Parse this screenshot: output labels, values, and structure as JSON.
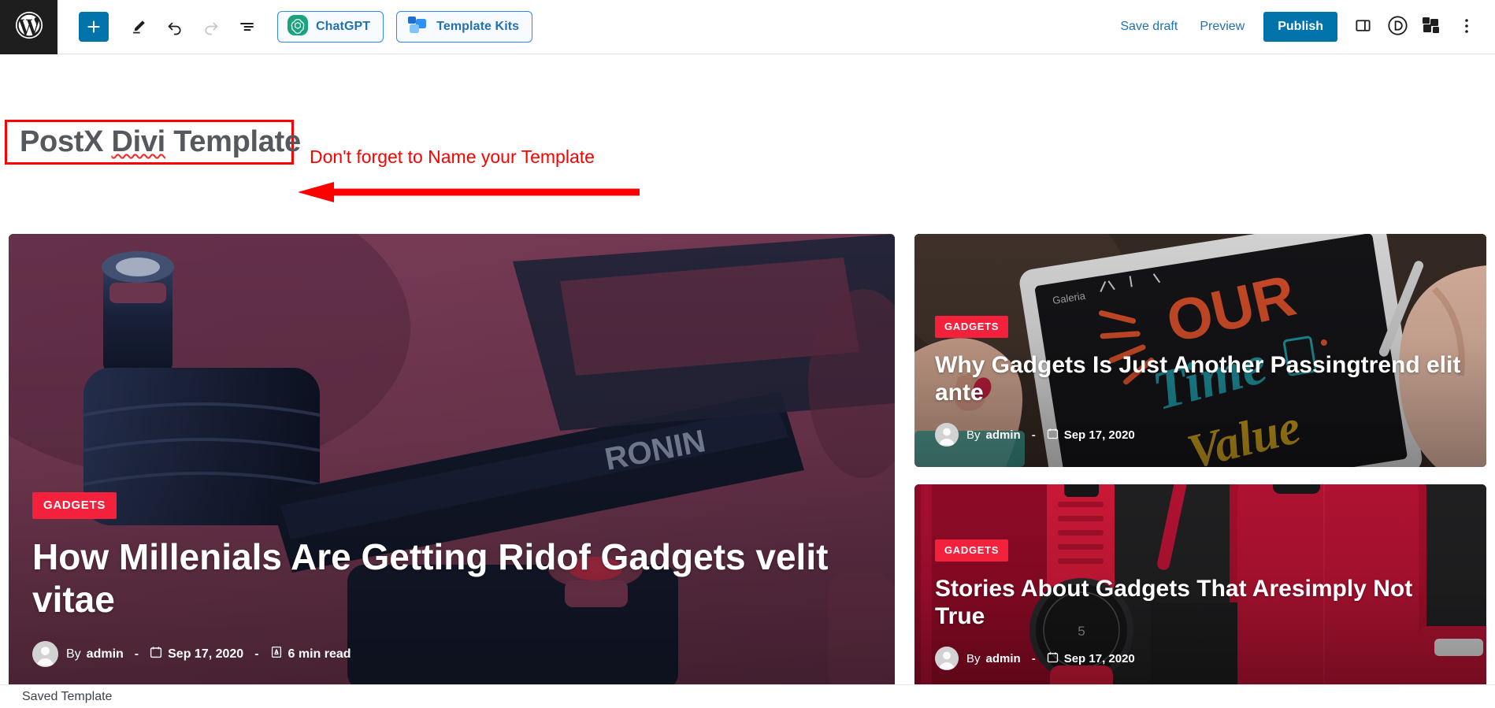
{
  "toolbar": {
    "wp_logo_icon": "wordpress-logo-icon",
    "left_tools": [
      {
        "name": "add-block-button",
        "icon": "plus-icon",
        "label": "Add block"
      },
      {
        "name": "tools-button",
        "icon": "pencil-icon",
        "label": "Tools"
      },
      {
        "name": "undo-button",
        "icon": "undo-arrow-icon",
        "label": "Undo"
      },
      {
        "name": "redo-button",
        "icon": "redo-arrow-icon",
        "label": "Redo"
      },
      {
        "name": "list-view-button",
        "icon": "document-outline-icon",
        "label": "Document Overview"
      }
    ],
    "chatgpt_pill": {
      "label": "ChatGPT",
      "icon": "chatgpt-logo-icon"
    },
    "template_kits_pill": {
      "label": "Template Kits",
      "icon": "template-kits-logo-icon"
    },
    "save_draft_label": "Save draft",
    "preview_label": "Preview",
    "publish_label": "Publish",
    "right_icons": [
      {
        "name": "settings-sidebar-toggle",
        "icon": "sidebar-panel-icon"
      },
      {
        "name": "divi-button",
        "icon": "divi-logo-icon"
      },
      {
        "name": "template-kits-button",
        "icon": "blocks-stack-icon"
      },
      {
        "name": "options-menu-button",
        "icon": "kebab-menu-icon"
      }
    ],
    "accent_blue": "#0073aa",
    "link_blue": "#2271b1"
  },
  "editor": {
    "title": {
      "text_before": "PostX ",
      "text_misspelled": "Divi",
      "text_after": " Template"
    },
    "annotation": {
      "text": "Don't forget to Name your Template",
      "color": "#ff0000",
      "arrow_direction": "left"
    }
  },
  "posts": {
    "featured": {
      "category": "GADGETS",
      "title": "How Millenials Are Getting Ridof Gadgets velit vitae",
      "by_label": "By",
      "author": "admin",
      "date": "Sep 17, 2020",
      "read_time": "6 min read",
      "separator": "-"
    },
    "side": [
      {
        "category": "GADGETS",
        "title": "Why Gadgets Is Just Another Passingtrend elit ante",
        "by_label": "By",
        "author": "admin",
        "date": "Sep 17, 2020",
        "separator": "-"
      },
      {
        "category": "GADGETS",
        "title": "Stories About Gadgets That Aresimply Not True",
        "by_label": "By",
        "author": "admin",
        "date": "Sep 17, 2020",
        "separator": "-"
      }
    ],
    "category_badge_color": "#f4213c"
  },
  "statusbar": {
    "text": "Saved Template"
  }
}
